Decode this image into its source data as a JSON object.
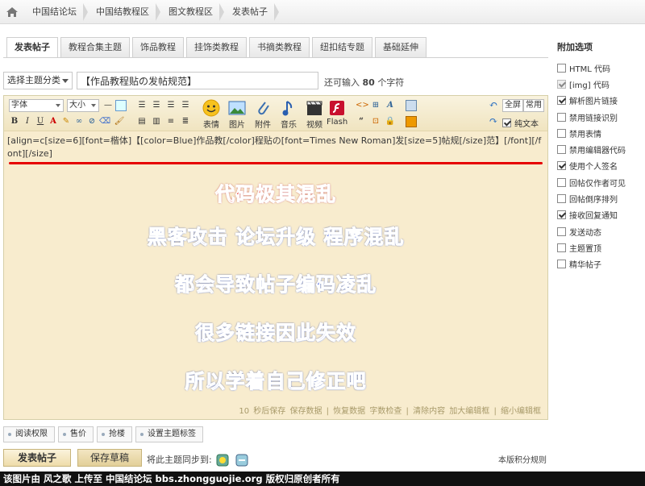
{
  "breadcrumb": [
    "中国结论坛",
    "中国结教程区",
    "图文教程区",
    "发表帖子"
  ],
  "tabs": [
    "发表帖子",
    "教程合集主题",
    "饰品教程",
    "挂饰类教程",
    "书摘类教程",
    "纽扣结专题",
    "基础延伸"
  ],
  "topic_select": "选择主题分类",
  "title_value": "【作品教程贴の发帖规范】",
  "title_hint_pre": "还可输入",
  "title_hint_num": "80",
  "title_hint_post": "个字符",
  "toolbar": {
    "font_select": "字体",
    "size_select": "大小",
    "big_buttons": [
      "表情",
      "图片",
      "附件",
      "音乐",
      "视频",
      "Flash"
    ],
    "fullscreen": "全屏",
    "common": "常用",
    "plain_text": "纯文本"
  },
  "editor": {
    "code": "[align=c[size=6][font=楷体]【[color=Blue]作品教[/color]程贴の[font=Times New Roman]发[size=5]帖规[/size]范】[/font][/font][/size]",
    "messages": [
      "代码极其混乱",
      "黑客攻击 论坛升级 程序混乱",
      "都会导致帖子编码凌乱",
      "很多链接因此失效",
      "所以学着自己修正吧"
    ],
    "status": "10 秒后保存 保存数据 | 恢复数据   字数检查 | 清除内容   加大编辑框 | 缩小编辑框"
  },
  "bottom_buttons": [
    "阅读权限",
    "售价",
    "抢楼",
    "设置主题标签"
  ],
  "post_button": "发表帖子",
  "draft_button": "保存草稿",
  "sync_label": "将此主题同步到:",
  "rules_link": "本版积分规则",
  "sidebar": {
    "heading": "附加选项",
    "options": [
      {
        "label": "HTML 代码",
        "checked": false,
        "disabled": false
      },
      {
        "label": "[img] 代码",
        "checked": true,
        "disabled": true
      },
      {
        "label": "解析图片链接",
        "checked": true,
        "disabled": false
      },
      {
        "label": "禁用链接识别",
        "checked": false,
        "disabled": false
      },
      {
        "label": "禁用表情",
        "checked": false,
        "disabled": false
      },
      {
        "label": "禁用编辑器代码",
        "checked": false,
        "disabled": false
      },
      {
        "label": "使用个人签名",
        "checked": true,
        "disabled": false
      },
      {
        "label": "回帖仅作者可见",
        "checked": false,
        "disabled": false
      },
      {
        "label": "回帖倒序排列",
        "checked": false,
        "disabled": false
      },
      {
        "label": "接收回复通知",
        "checked": true,
        "disabled": false
      },
      {
        "label": "发送动态",
        "checked": false,
        "disabled": false
      },
      {
        "label": "主题置顶",
        "checked": false,
        "disabled": false
      },
      {
        "label": "精华帖子",
        "checked": false,
        "disabled": false
      }
    ]
  },
  "footer": "该图片由 风之歌 上传至 中国结论坛 bbs.zhongguojie.org 版权归原创者所有",
  "colors": {
    "accent_red": "#e60000",
    "message_blue": "#1f3dd6",
    "editor_bg": "#f8ecce"
  }
}
